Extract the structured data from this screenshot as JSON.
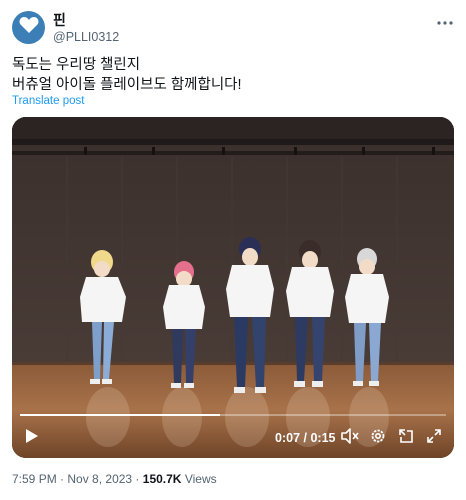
{
  "author": {
    "display_name": "핀",
    "handle": "@PLLI0312"
  },
  "post": {
    "lines": [
      "독도는 우리땅 챌린지",
      "버츄얼 아이돌 플레이브도 함께합니다!"
    ],
    "translate_label": "Translate post"
  },
  "video": {
    "current_time": "0:07",
    "duration": "0:15",
    "time_separator": " / ",
    "progress": 0.47
  },
  "meta": {
    "time": "7:59 PM",
    "date": "Nov 8, 2023",
    "views_count": "150.7K",
    "views_label": "Views",
    "separator": " · "
  },
  "icons": {
    "avatar": "heart-icon",
    "more": "more-icon",
    "play": "play-icon",
    "volume": "volume-muted-icon",
    "settings": "gear-icon",
    "pip": "picture-in-picture-icon",
    "fullscreen": "fullscreen-icon"
  },
  "colors": {
    "accent": "#1d9bf0",
    "avatar_bg": "#3b7fb6",
    "text_primary": "#0f1419",
    "text_secondary": "#536471"
  }
}
